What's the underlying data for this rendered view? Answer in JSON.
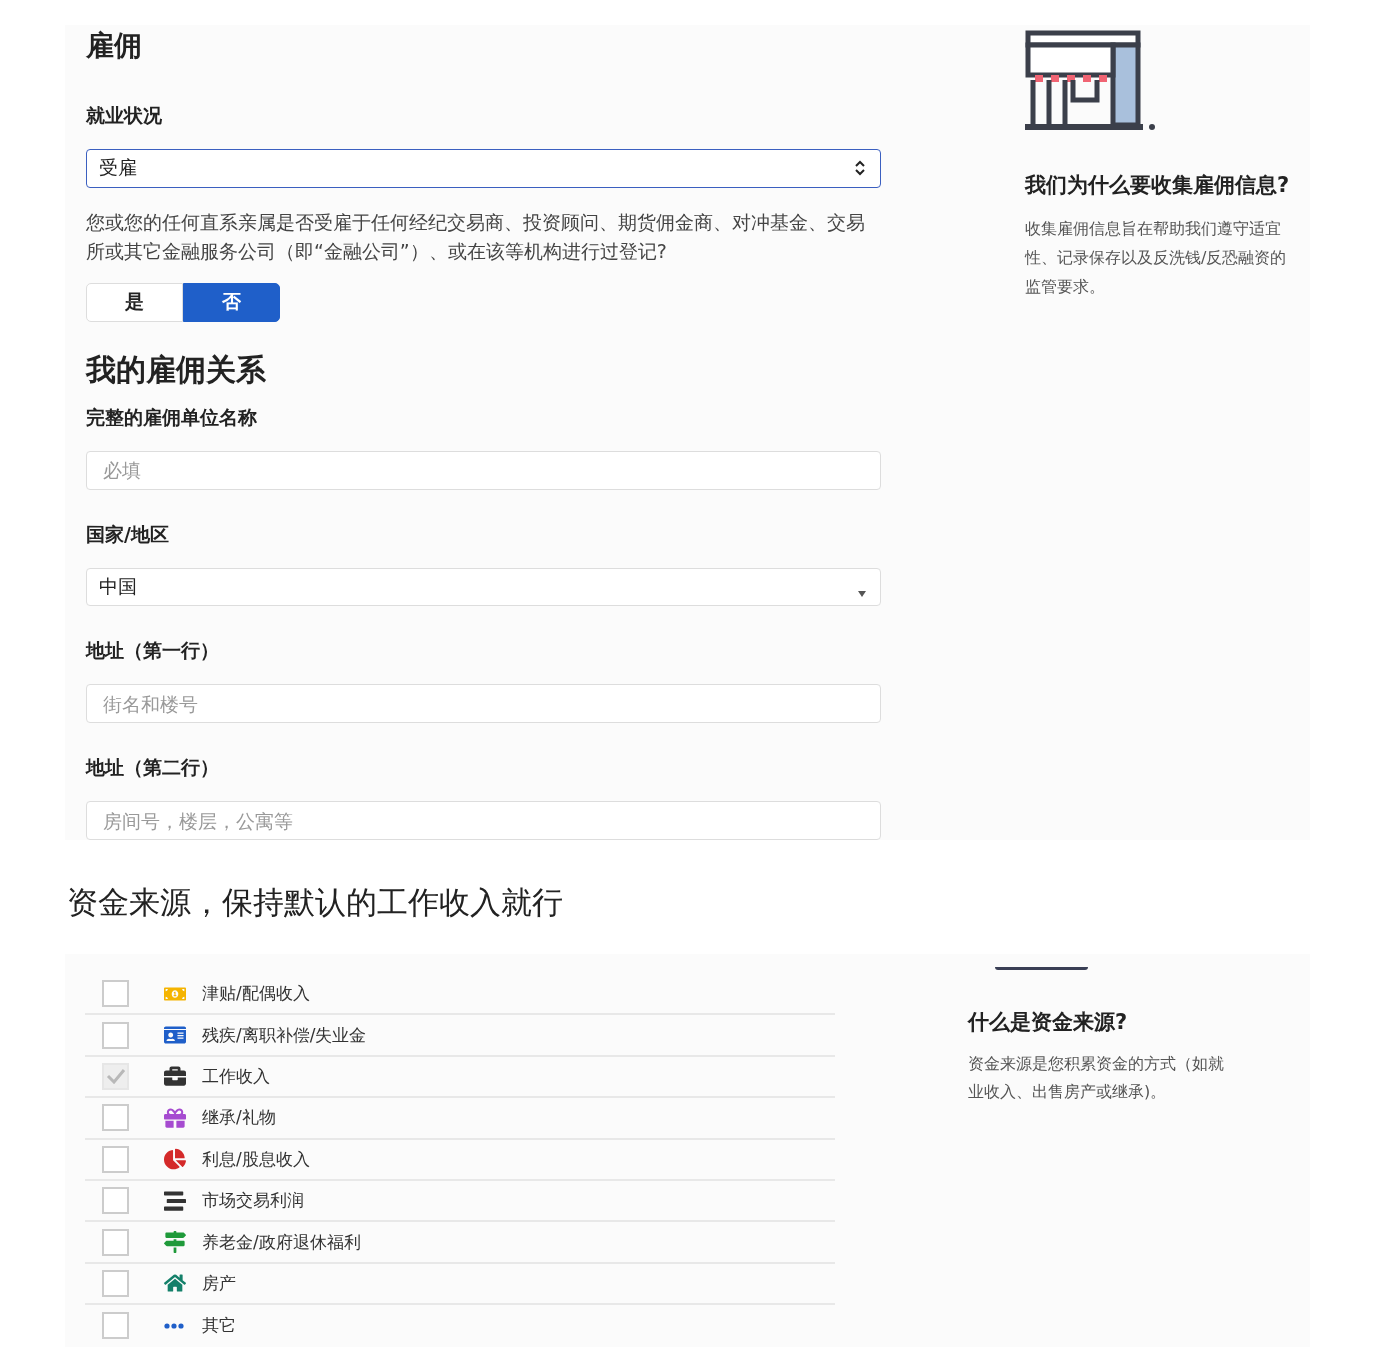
{
  "employment": {
    "title": "雇佣",
    "status_label": "就业状况",
    "status_value": "受雇",
    "question": "您或您的任何直系亲属是否受雇于任何经纪交易商、投资顾问、期货佣金商、对冲基金、交易所或其它金融服务公司（即“金融公司”）、或在该等机构进行过登记?",
    "answer_options": [
      {
        "label": "是",
        "selected": false
      },
      {
        "label": "否",
        "selected": true
      }
    ],
    "relation_title": "我的雇佣关系",
    "fields": [
      {
        "kind": "input",
        "label": "完整的雇佣单位名称",
        "placeholder": "必填"
      },
      {
        "kind": "select",
        "label": "国家/地区",
        "value": "中国"
      },
      {
        "kind": "input",
        "label": "地址（第一行）",
        "placeholder": "街名和楼号"
      },
      {
        "kind": "input",
        "label": "地址（第二行）",
        "placeholder": "房间号，楼层，公寓等"
      }
    ]
  },
  "employment_info": {
    "title": "我们为什么要收集雇佣信息?",
    "text": "收集雇佣信息旨在帮助我们遵守适宜性、记录保存以及反洗钱/反恐融资的监管要求。"
  },
  "caption": "资金来源，保持默认的工作收入就行",
  "sources": [
    {
      "kind": "money",
      "label": "津贴/配偶收入",
      "checked": false
    },
    {
      "kind": "idcard",
      "label": "残疾/离职补偿/失业金",
      "checked": false
    },
    {
      "kind": "briefcase",
      "label": "工作收入",
      "checked": true
    },
    {
      "kind": "gift",
      "label": "继承/礼物",
      "checked": false
    },
    {
      "kind": "pie",
      "label": "利息/股息收入",
      "checked": false
    },
    {
      "kind": "chart",
      "label": "市场交易利润",
      "checked": false
    },
    {
      "kind": "sign",
      "label": "养老金/政府退休福利",
      "checked": false
    },
    {
      "kind": "house",
      "label": "房产",
      "checked": false
    },
    {
      "kind": "more",
      "label": "其它",
      "checked": false
    }
  ],
  "sources_info": {
    "title": "什么是资金来源?",
    "text": "资金来源是您积累资金的方式（如就业收入、出售房产或继承)。"
  }
}
